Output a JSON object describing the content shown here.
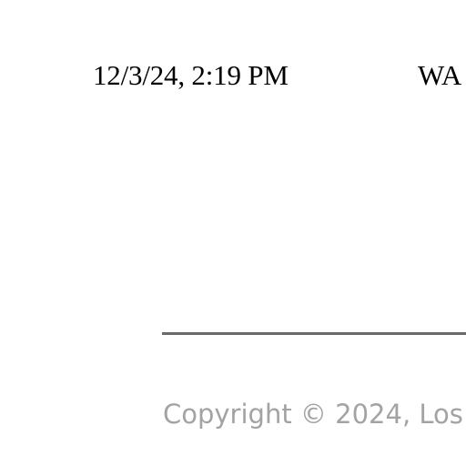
{
  "print_header": {
    "timestamp": "12/3/24, 2:19 PM",
    "page_title": "WA"
  },
  "footer": {
    "copyright": "Copyright © 2024, Los"
  },
  "colors": {
    "text": "#000000",
    "rule": "#6a6a6a",
    "footer_text": "#a3a3a3",
    "background": "#ffffff"
  }
}
